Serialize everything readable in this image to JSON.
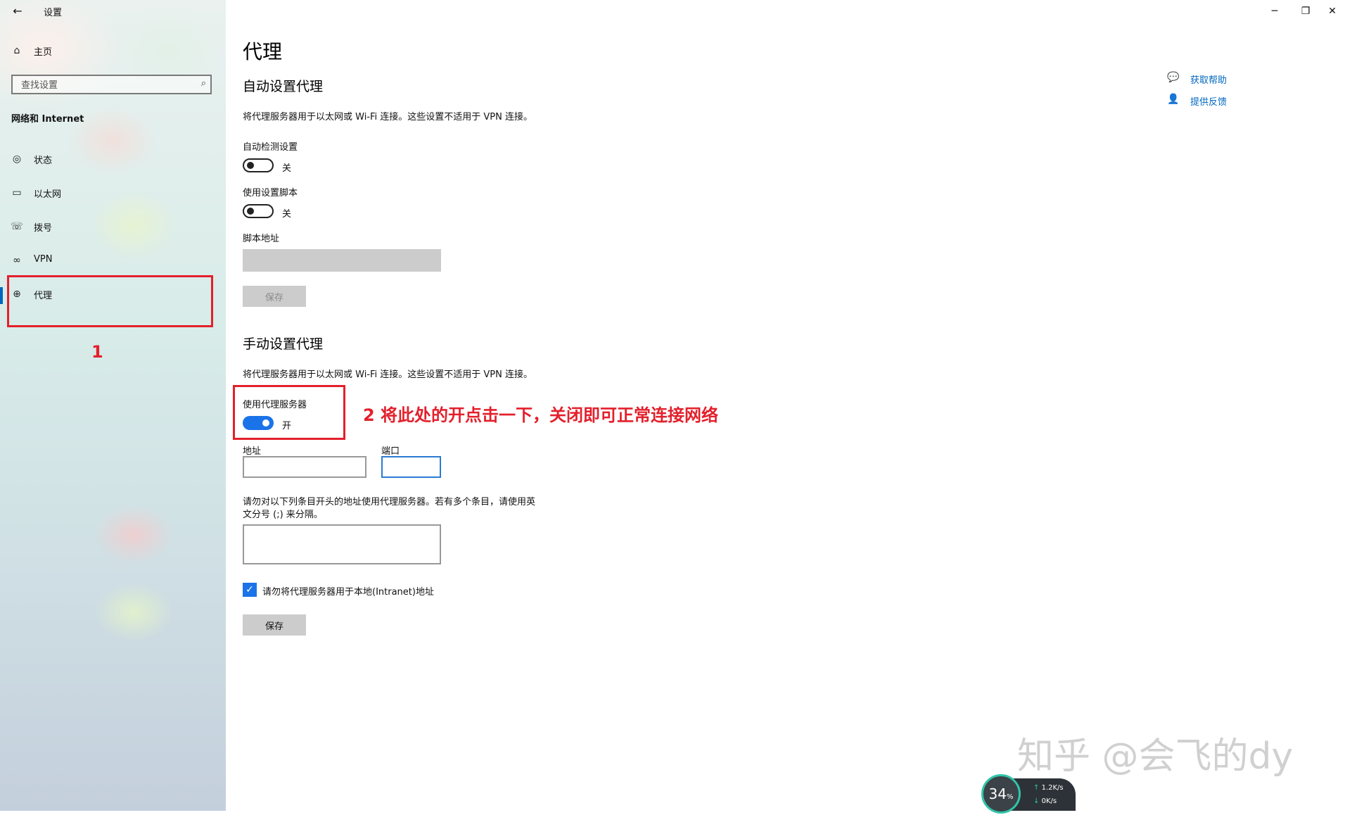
{
  "window": {
    "title": "设置",
    "controls": {
      "minimize": "─",
      "restore": "❐",
      "close": "✕"
    }
  },
  "sidebar": {
    "back_icon": "arrow-left-icon",
    "home": {
      "icon": "home-icon",
      "label": "主页"
    },
    "search": {
      "placeholder": "查找设置",
      "icon": "search-icon"
    },
    "section_title": "网络和 Internet",
    "items": [
      {
        "icon": "status-icon",
        "label": "状态"
      },
      {
        "icon": "ethernet-icon",
        "label": "以太网"
      },
      {
        "icon": "dialup-icon",
        "label": "拨号"
      },
      {
        "icon": "vpn-icon",
        "label": "VPN"
      },
      {
        "icon": "globe-icon",
        "label": "代理",
        "selected": true
      }
    ],
    "annotation_number": "1"
  },
  "main": {
    "page_title": "代理",
    "auto": {
      "heading": "自动设置代理",
      "description": "将代理服务器用于以太网或 Wi-Fi 连接。这些设置不适用于 VPN 连接。",
      "detect_label": "自动检测设置",
      "detect_state": "关",
      "script_label": "使用设置脚本",
      "script_state": "关",
      "script_address_label": "脚本地址",
      "script_address_value": "",
      "save_label": "保存"
    },
    "manual": {
      "heading": "手动设置代理",
      "description": "将代理服务器用于以太网或 Wi-Fi 连接。这些设置不适用于 VPN 连接。",
      "use_proxy_label": "使用代理服务器",
      "use_proxy_state": "开",
      "address_label": "地址",
      "address_value": "",
      "port_label": "端口",
      "port_value": "",
      "exceptions_line1": "请勿对以下列条目开头的地址使用代理服务器。若有多个条目，请使用英",
      "exceptions_line2": "文分号 (;) 来分隔。",
      "exceptions_value": "",
      "bypass_local_label": "请勿将代理服务器用于本地(Intranet)地址",
      "bypass_local_checked": true,
      "save_label": "保存"
    },
    "help": {
      "get_help": "获取帮助",
      "get_help_icon": "chat-help-icon",
      "feedback": "提供反馈",
      "feedback_icon": "feedback-person-icon"
    },
    "annotation_text": "2 将此处的开点击一下，关闭即可正常连接网络",
    "watermark": "知乎 @会飞的dy"
  },
  "net_monitor": {
    "cpu_percent": "34",
    "cpu_unit": "%",
    "upload": "1.2K/s",
    "download": "0K/s"
  },
  "colors": {
    "accent": "#0067c0",
    "toggle_on": "#1a73e8",
    "annotation_red": "#e3202c",
    "disabled_gray": "#cccccc"
  }
}
